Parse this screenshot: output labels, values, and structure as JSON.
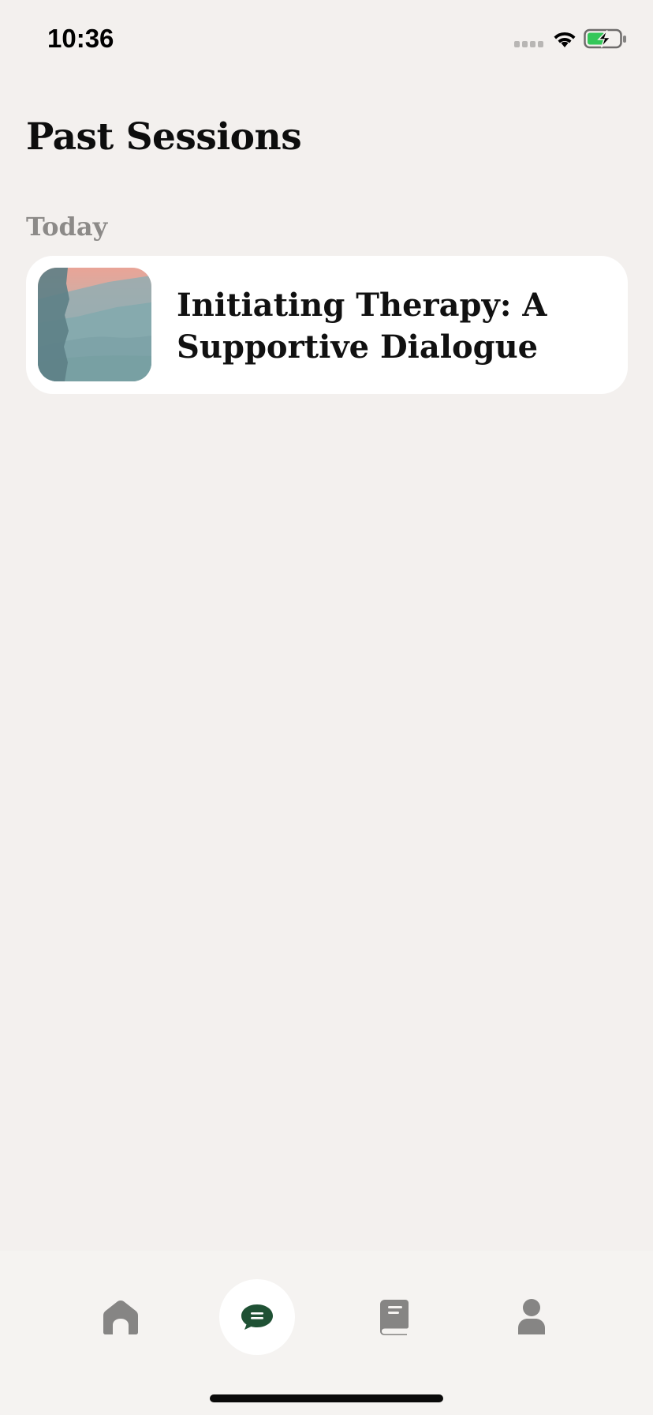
{
  "status_bar": {
    "time": "10:36",
    "icons": [
      "signal-dots-icon",
      "wifi-icon",
      "battery-charging-icon"
    ],
    "battery_color": "#34c759"
  },
  "header": {
    "title": "Past Sessions"
  },
  "sections": [
    {
      "label": "Today",
      "sessions": [
        {
          "title": "Initiating Therapy: A Supportive Dialogue",
          "thumbnail": "misty-mountains-landscape"
        }
      ]
    }
  ],
  "tab_bar": {
    "tabs": [
      {
        "name": "home",
        "icon": "home-icon",
        "active": false
      },
      {
        "name": "sessions",
        "icon": "chat-icon",
        "active": true
      },
      {
        "name": "journal",
        "icon": "book-icon",
        "active": false
      },
      {
        "name": "profile",
        "icon": "person-icon",
        "active": false
      }
    ],
    "active_color": "#1f5134",
    "inactive_color": "#868584"
  }
}
